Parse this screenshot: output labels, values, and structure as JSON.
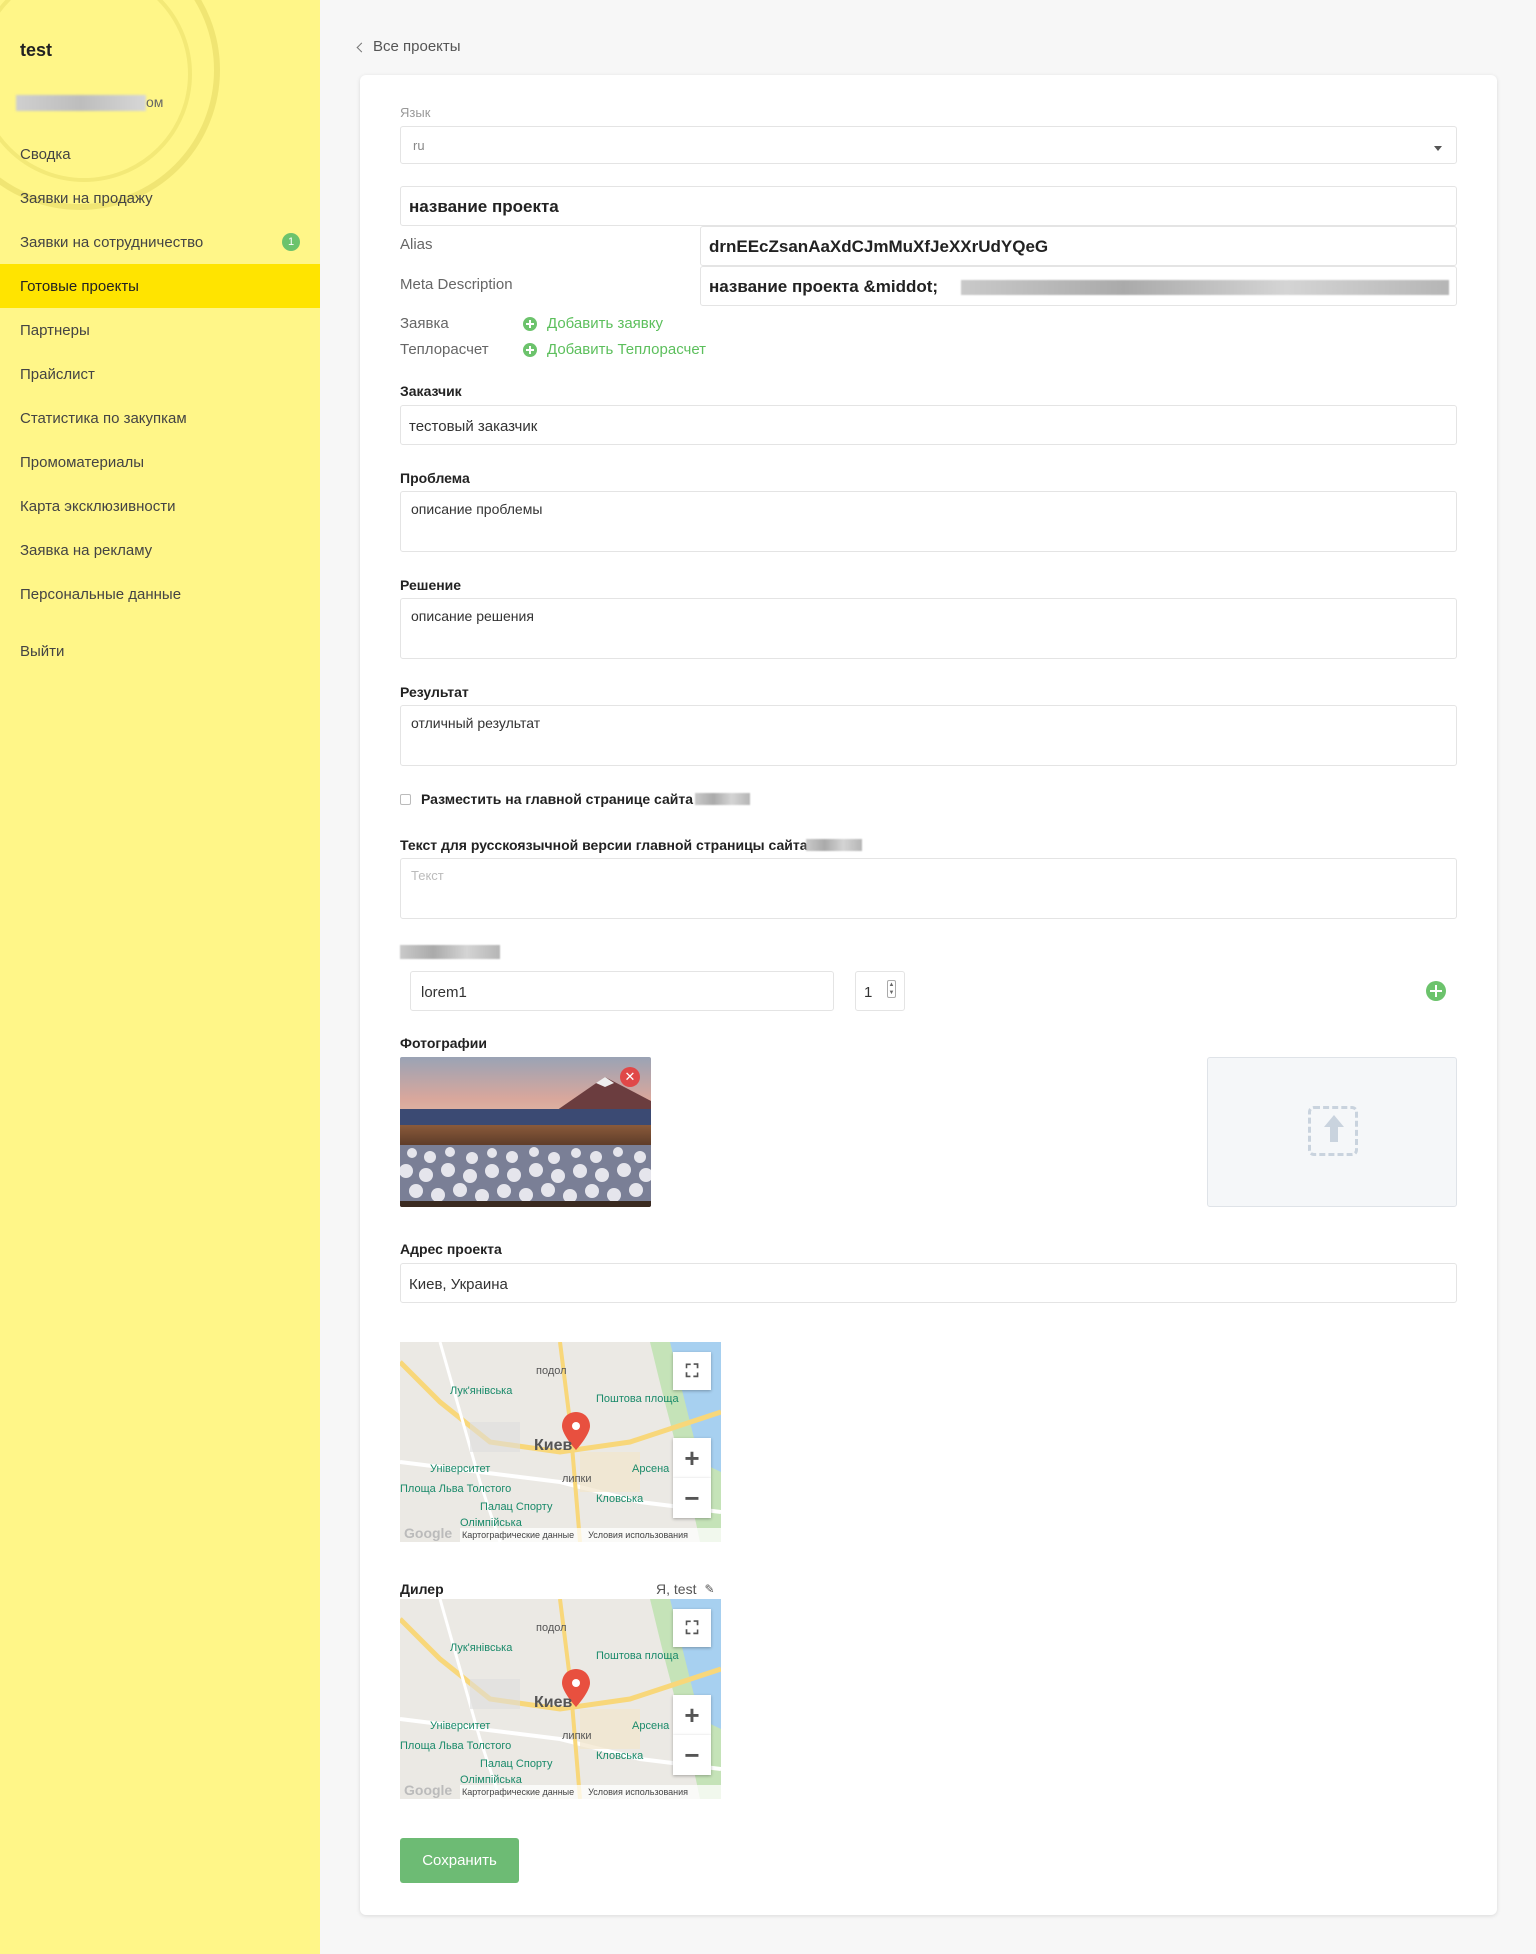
{
  "sidebar": {
    "user_name": "test",
    "user_email_suffix": "ом",
    "items": [
      {
        "label": "Сводка"
      },
      {
        "label": "Заявки на продажу"
      },
      {
        "label": "Заявки на сотрудничество",
        "badge": "1"
      },
      {
        "label": "Готовые проекты",
        "active": true
      },
      {
        "label": "Партнеры"
      },
      {
        "label": "Прайслист"
      },
      {
        "label": "Статистика по закупкам"
      },
      {
        "label": "Промоматериалы"
      },
      {
        "label": "Карта эксклюзивности"
      },
      {
        "label": "Заявка на рекламу"
      },
      {
        "label": "Персональные данные"
      }
    ],
    "logout": "Выйти"
  },
  "header": {
    "back_link": "Все проекты"
  },
  "form": {
    "language_label": "Язык",
    "language_value": "ru",
    "project_name": "название проекта",
    "alias_label": "Alias",
    "alias_value": "drnEEcZsanAaXdCJmMuXfJeXXrUdYQeG",
    "meta_label": "Meta Description",
    "meta_value": "название проекта &middot;",
    "request_label": "Заявка",
    "request_add": "Добавить заявку",
    "heat_label": "Теплорасчет",
    "heat_add": "Добавить Теплорасчет",
    "customer_label": "Заказчик",
    "customer_value": "тестовый заказчик",
    "problem_label": "Проблема",
    "problem_value": "описание проблемы",
    "solution_label": "Решение",
    "solution_value": "описание решения",
    "result_label": "Результат",
    "result_value": "отличный результат",
    "main_page_checkbox": "Разместить на главной странице сайта",
    "main_text_label": "Текст для русскоязычной версии главной страницы сайта",
    "main_text_placeholder": "Текст",
    "item_name": "lorem1",
    "item_qty": "1",
    "photos_label": "Фотографии",
    "address_label": "Адрес проекта",
    "address_value": "Киев, Украина",
    "dealer_label": "Дилер",
    "dealer_value": "Я, test",
    "save_label": "Сохранить"
  },
  "map": {
    "city": "Киев",
    "labels": [
      "подол",
      "Лук'янівська",
      "Поштова площа",
      "Університет",
      "Арсена",
      "липки",
      "Площа Льва Толстого",
      "Кловська",
      "Палац Спорту",
      "Олімпійська"
    ],
    "footer_data": "Картографические данные",
    "footer_terms": "Условия использования",
    "brand": "Google"
  },
  "colors": {
    "sidebar_bg": "#fff688",
    "active_item": "#ffe400",
    "accent_green": "#6dbb74"
  }
}
